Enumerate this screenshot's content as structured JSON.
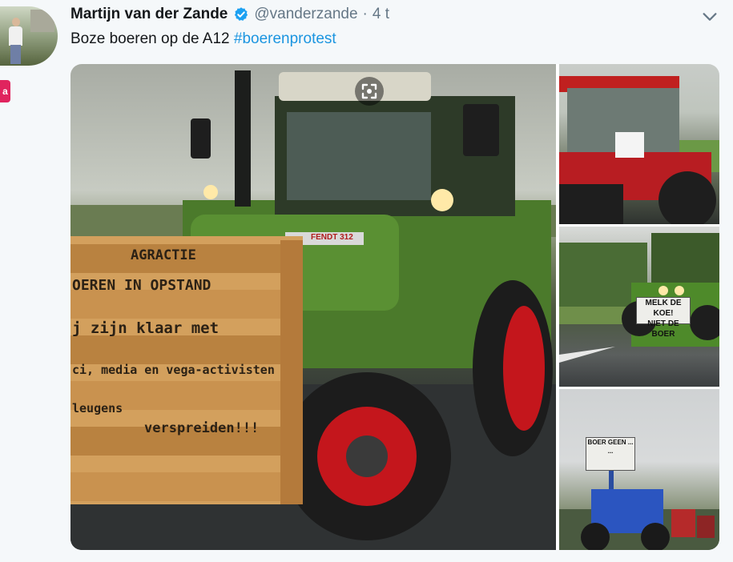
{
  "author": {
    "display_name": "Martijn van der Zande",
    "handle": "@vanderzande",
    "time": "4 t",
    "verified": true,
    "avatar_icon": "profile-photo-icon"
  },
  "side_badge": {
    "label": "a"
  },
  "tweet": {
    "text": "Boze boeren op de A12 ",
    "hashtag": "#boerenprotest"
  },
  "media": {
    "photos": [
      {
        "id": "main",
        "sign_lines": [
          "AGRACTIE",
          "OEREN IN OPSTAND",
          "j zijn klaar met",
          "ci, media en vega-activisten",
          "leugens",
          "verspreiden!!!"
        ],
        "tractor_badge": "FENDT 312"
      },
      {
        "id": "top-right"
      },
      {
        "id": "middle-right",
        "sign_lines": [
          "MELK DE KOE!",
          "NIET DE BOER"
        ]
      },
      {
        "id": "bottom-right",
        "sign_lines": [
          "BOER GEEN ...",
          "..."
        ]
      }
    ]
  },
  "colors": {
    "verified_blue": "#1da1f2",
    "hashtag_blue": "#1b95e0",
    "badge_red": "#e0245e"
  }
}
